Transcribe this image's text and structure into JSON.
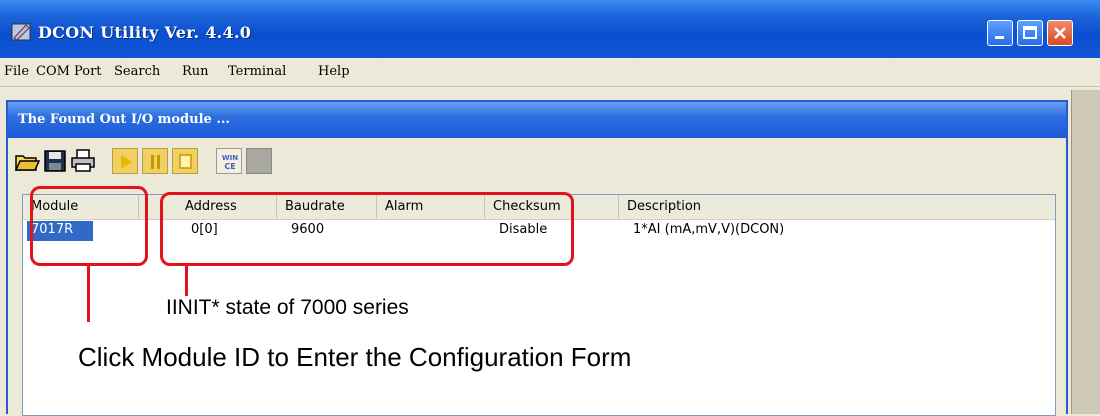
{
  "window": {
    "title": "DCON Utility Ver.  4.4.0",
    "app_icon": "dcon-app-icon",
    "controls": [
      "minimize-icon",
      "maximize-icon",
      "close-icon"
    ]
  },
  "menubar": {
    "items": [
      "File",
      "COM Port",
      "Search",
      "Run",
      "Terminal",
      "Help"
    ]
  },
  "child_window": {
    "title": "The Found Out I/O module ..."
  },
  "toolbar": {
    "icons": [
      "open-folder-icon",
      "save-icon",
      "print-icon",
      "play-icon",
      "pause-icon",
      "stop-icon",
      "wince-icon",
      "blank-button-icon"
    ],
    "wince_label_top": "WIN",
    "wince_label_bottom": "CE"
  },
  "list": {
    "columns": [
      "Module",
      "Address",
      "Baudrate",
      "Alarm",
      "Checksum",
      "Description"
    ],
    "rows": [
      {
        "module": "7017R",
        "address": "0[0]",
        "baudrate": "9600",
        "alarm": "",
        "checksum": "Disable",
        "description": "1*AI (mA,mV,V)(DCON)"
      }
    ]
  },
  "annotations": {
    "init_state": "IINIT* state of 7000 series",
    "click_hint": "Click Module ID to Enter the Configuration Form",
    "highlight_color": "#e0141a"
  },
  "colors": {
    "titlebar": "#0a4fd0",
    "selection": "#316ac5"
  }
}
